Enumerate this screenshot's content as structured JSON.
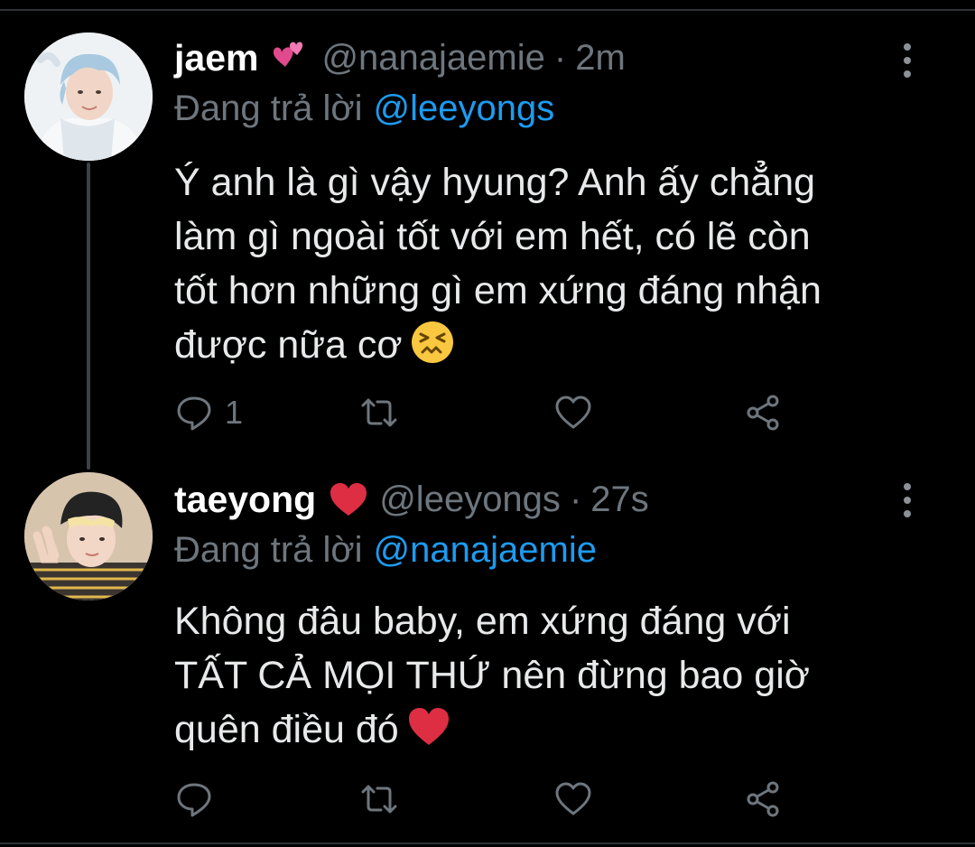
{
  "colors": {
    "background": "#000000",
    "text": "#e7e9ea",
    "muted": "#6e767d",
    "link": "#1d9bf0",
    "divider": "#2f3336"
  },
  "tweets": [
    {
      "display_name": "jaem",
      "name_emoji": "two-hearts-emoji",
      "handle": "@nanajaemie",
      "separator": "·",
      "time": "2m",
      "reply_prefix": "Đang trả lời",
      "reply_to": "@leeyongs",
      "text_lines": [
        "Ý anh là gì vậy hyung? Anh ấy chẳng",
        "làm gì ngoài tốt với em hết, có lẽ còn",
        "tốt hơn những gì em xứng đáng nhận",
        "được nữa cơ"
      ],
      "text_emoji": "confounded-face-emoji",
      "reply_count": "1",
      "retweet_count": "",
      "like_count": ""
    },
    {
      "display_name": "taeyong",
      "name_emoji": "red-heart-emoji",
      "handle": "@leeyongs",
      "separator": "·",
      "time": "27s",
      "reply_prefix": "Đang trả lời",
      "reply_to": "@nanajaemie",
      "text_lines": [
        "Không đâu baby, em xứng đáng với",
        "TẤT CẢ MỌI THỨ nên đừng bao giờ",
        "quên điều đó"
      ],
      "text_emoji": "red-heart-emoji",
      "reply_count": "",
      "retweet_count": "",
      "like_count": ""
    }
  ]
}
